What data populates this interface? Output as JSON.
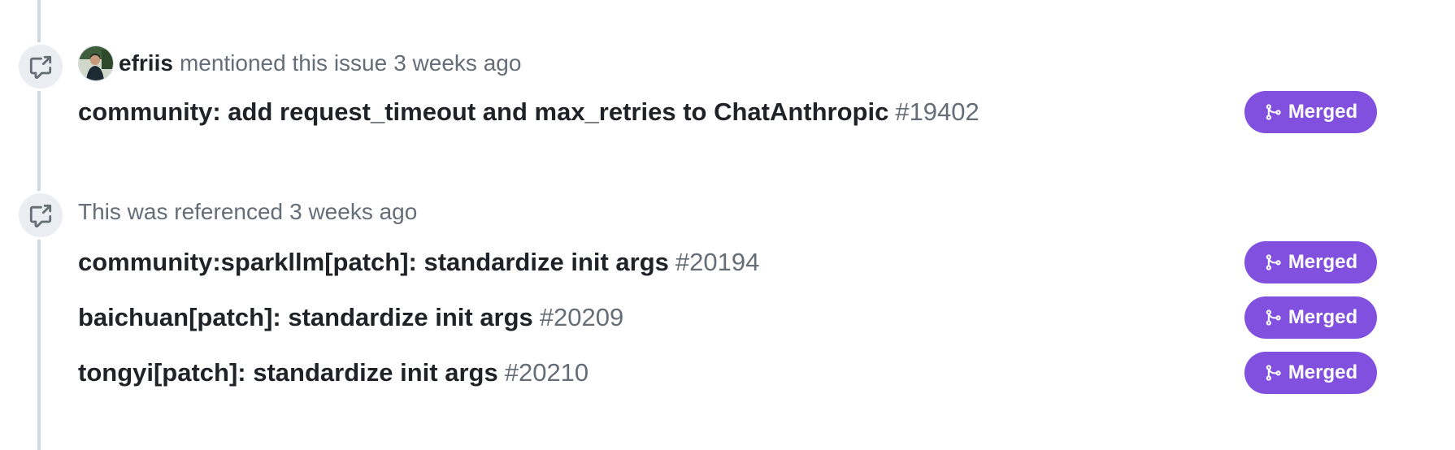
{
  "timeline": {
    "event1": {
      "icon": "cross-reference-icon",
      "author": "efriis",
      "action": "mentioned this issue",
      "time": "3 weeks ago",
      "refs": [
        {
          "title": "community: add request_timeout and max_retries to ChatAnthropic",
          "number": "#19402",
          "state": "Merged"
        }
      ]
    },
    "event2": {
      "icon": "cross-reference-icon",
      "text": "This was referenced",
      "time": "3 weeks ago",
      "refs": [
        {
          "title": "community:sparkllm[patch]: standardize init args",
          "number": "#20194",
          "state": "Merged"
        },
        {
          "title": "baichuan[patch]: standardize init args",
          "number": "#20209",
          "state": "Merged"
        },
        {
          "title": "tongyi[patch]: standardize init args",
          "number": "#20210",
          "state": "Merged"
        }
      ]
    }
  },
  "colors": {
    "merged": "#8250df",
    "muted_text": "#656d76",
    "text": "#1f2328",
    "timeline": "#d0d7de"
  }
}
